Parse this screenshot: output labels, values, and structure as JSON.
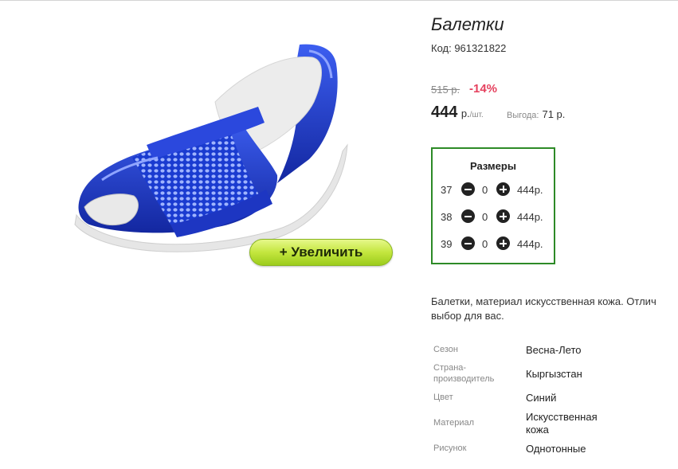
{
  "product": {
    "title": "Балетки",
    "code": "Код: 961321822",
    "old_price": "515 р.",
    "discount": "-14%",
    "price": "444",
    "price_unit": "р.",
    "price_unit_small": "/шт.",
    "savings_label": "Выгода:",
    "savings_value": "71 р.",
    "zoom_button": "+ Увеличить",
    "shoe_color": "#1f3fcc"
  },
  "sizes": {
    "title": "Размеры",
    "rows": [
      {
        "size": "37",
        "qty": "0",
        "price": "444р."
      },
      {
        "size": "38",
        "qty": "0",
        "price": "444р."
      },
      {
        "size": "39",
        "qty": "0",
        "price": "444р."
      }
    ]
  },
  "description": {
    "line1": "Балетки, материал искусственная кожа. Отлич",
    "line2": "выбор для вас."
  },
  "attributes": [
    {
      "label_lines": [
        "Сезон"
      ],
      "value_lines": [
        "Весна-Лето"
      ]
    },
    {
      "label_lines": [
        "Страна-",
        "производитель"
      ],
      "value_lines": [
        "Кыргызстан"
      ]
    },
    {
      "label_lines": [
        "Цвет"
      ],
      "value_lines": [
        "Синий"
      ]
    },
    {
      "label_lines": [
        "Материал"
      ],
      "value_lines": [
        "Искусственная",
        "кожа"
      ]
    },
    {
      "label_lines": [
        "Рисунок"
      ],
      "value_lines": [
        "Однотонные"
      ]
    }
  ]
}
